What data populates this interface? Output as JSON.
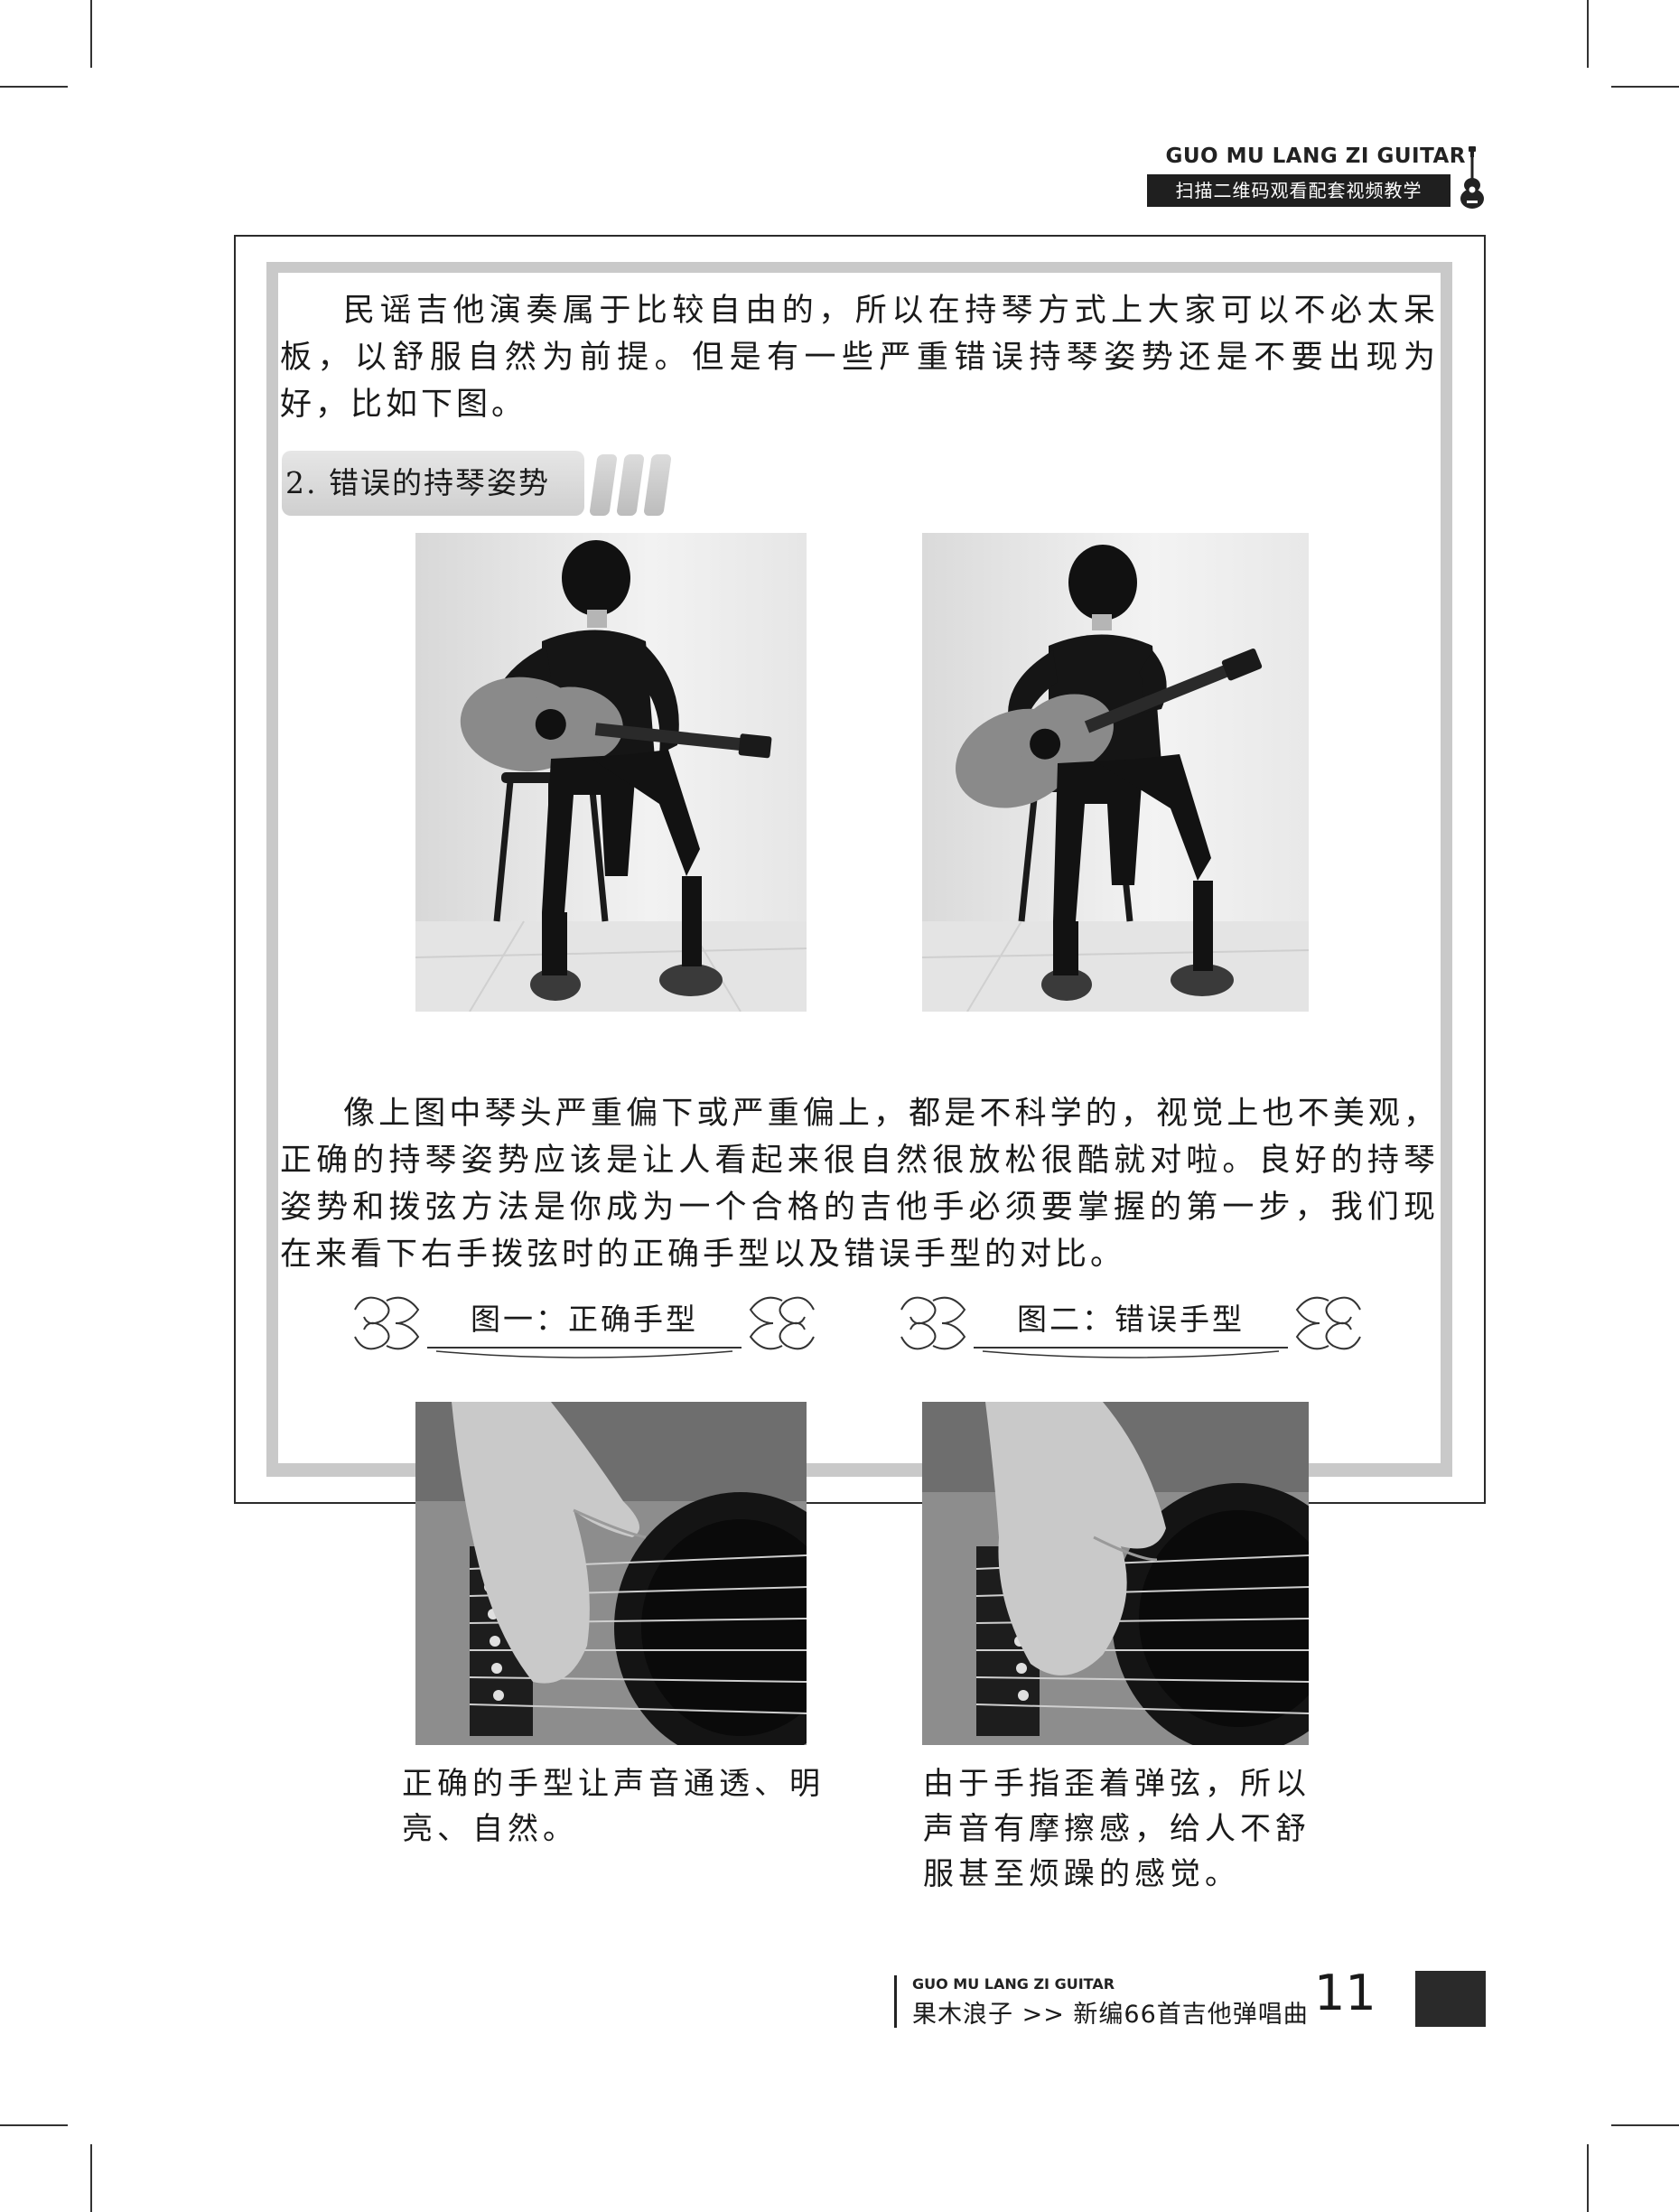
{
  "header": {
    "brand_en": "GUO MU LANG ZI GUITAR",
    "subtitle": "扫描二维码观看配套视频教学",
    "icon": "guitar-icon"
  },
  "intro_paragraph": "民谣吉他演奏属于比较自由的，所以在持琴方式上大家可以不必太呆板，以舒服自然为前提。但是有一些严重错误持琴姿势还是不要出现为好，比如下图。",
  "section": {
    "title": "2. 错误的持琴姿势"
  },
  "photos_top": [
    {
      "name": "guitar-headstock-too-low-photo"
    },
    {
      "name": "guitar-headstock-too-high-photo"
    }
  ],
  "body_paragraph": "像上图中琴头严重偏下或严重偏上，都是不科学的，视觉上也不美观，正确的持琴姿势应该是让人看起来很自然很放松很酷就对啦。良好的持琴姿势和拨弦方法是你成为一个合格的吉他手必须要掌握的第一步，我们现在来看下右手拨弦时的正确手型以及错误手型的对比。",
  "figures": [
    {
      "label": "图一：正确手型",
      "caption": "正确的手型让声音通透、明亮、自然。"
    },
    {
      "label": "图二：错误手型",
      "caption": "由于手指歪着弹弦，所以声音有摩擦感，给人不舒服甚至烦躁的感觉。"
    }
  ],
  "footer": {
    "brand_en": "GUO MU LANG ZI GUITAR",
    "book_title": "果木浪子 >> 新编66首吉他弹唱曲",
    "page_number": "11"
  }
}
